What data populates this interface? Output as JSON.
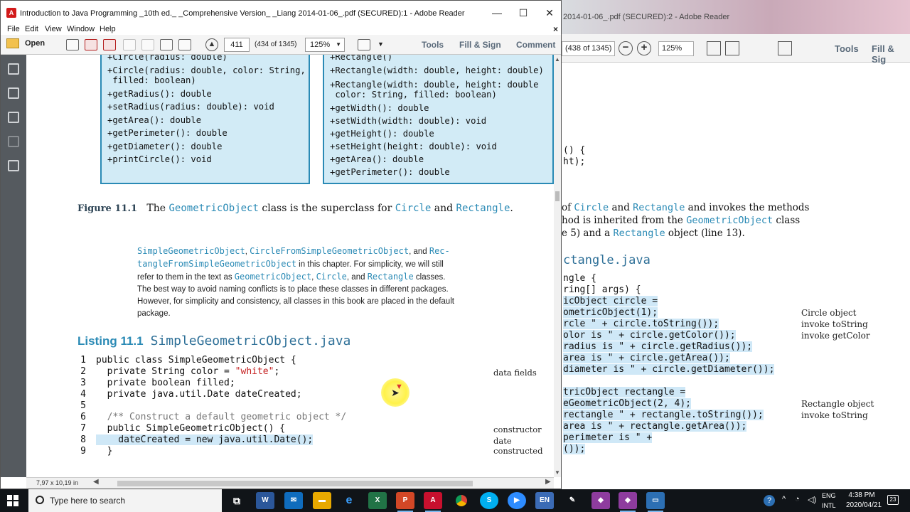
{
  "background_window": {
    "title": "2014-01-06_.pdf (SECURED):2 - Adobe Reader",
    "page_count": "(438 of 1345)",
    "zoom": "125%",
    "tools_label": "Tools",
    "fill_sign_label": "Fill & Sig",
    "code_top": [
      "() {",
      "ht);"
    ],
    "text_lines": [
      {
        "pre": "of ",
        "k1": "Circle",
        "mid": " and ",
        "k2": "Rectangle",
        "post": " and invokes the methods"
      },
      {
        "pre": "hod is inherited from the ",
        "k1": "GeometricObject",
        "mid": " class",
        "k2": "",
        "post": ""
      },
      {
        "pre": "e 5) and a ",
        "k1": "Rectangle",
        "mid": " object (line 13).",
        "k2": "",
        "post": ""
      }
    ],
    "heading": "ctangle.java",
    "code_lines": [
      "ngle {",
      "ring[] args) {",
      "icObject circle =",
      "ometricObject(1);",
      "rcle \" + circle.toString());",
      "olor is \" + circle.getColor());",
      "radius is \" + circle.getRadius());",
      "area is \" + circle.getArea());",
      "diameter is \" + circle.getDiameter());",
      "",
      "tricObject rectangle =",
      "eGeometricObject(2, 4);",
      "rectangle \" + rectangle.toString());",
      "area is \" + rectangle.getArea());",
      "perimeter is \" +",
      "());"
    ],
    "annotations": [
      "Circle object",
      "invoke toString",
      "invoke getColor",
      "Rectangle object",
      "invoke toString"
    ]
  },
  "window": {
    "title": "Introduction to Java Programming _10th ed._ _Comprehensive Version_ _Liang 2014-01-06_.pdf (SECURED):1 - Adobe Reader",
    "minimize": "—",
    "maximize": "☐",
    "close": "✕"
  },
  "menu": [
    "File",
    "Edit",
    "View",
    "Window",
    "Help"
  ],
  "menu_close": "×",
  "toolbar": {
    "open_label": "Open",
    "page_number": "411",
    "page_count": "(434 of 1345)",
    "zoom": "125%",
    "tools_label": "Tools",
    "fill_sign_label": "Fill & Sign",
    "comment_label": "Comment"
  },
  "page": {
    "circle_uml": [
      "+Circle(radius: double)",
      "+Circle(radius: double, color: String,",
      " filled: boolean)",
      "+getRadius(): double",
      "+setRadius(radius: double): void",
      "+getArea(): double",
      "+getPerimeter(): double",
      "+getDiameter(): double",
      "+printCircle(): void"
    ],
    "rectangle_uml": [
      "+Rectangle()",
      "+Rectangle(width: double, height: double)",
      "+Rectangle(width: double, height: double",
      " color: String, filled: boolean)",
      "+getWidth(): double",
      "+setWidth(width: double): void",
      "+getHeight(): double",
      "+setHeight(height: double): void",
      "+getArea(): double",
      "+getPerimeter(): double"
    ],
    "figure": {
      "label": "Figure 11.1",
      "pre": "The ",
      "k1": "GeometricObject",
      "mid1": " class is the superclass for ",
      "k2": "Circle",
      "mid2": " and ",
      "k3": "Rectangle",
      "post": "."
    },
    "note": {
      "k1": "SimpleGeometricObject",
      "k2": "CircleFromSimpleGeometricObject",
      "and": ", and ",
      "k3a": "Rec-",
      "k3b": "tangleFromSimpleGeometricObject",
      "t1": " in this chapter. For simplicity, we will still",
      "t2": "refer to them in the text as ",
      "k4": "GeometricObject",
      "k5": "Circle",
      "k6": "Rectangle",
      "t3": " classes.",
      "t4": "The best way to avoid naming conflicts is to place these classes in different packages.",
      "t5": "However, for simplicity and consistency, all classes in this book are placed in the default",
      "t6": "package."
    },
    "listing": {
      "label": "Listing 11.1",
      "file": "SimpleGeometricObject.java"
    },
    "code": [
      {
        "n": "1",
        "t": "public class SimpleGeometricObject {"
      },
      {
        "n": "2",
        "t": "  private String color = ",
        "s": "\"white\"",
        "e": ";"
      },
      {
        "n": "3",
        "t": "  private boolean filled;"
      },
      {
        "n": "4",
        "t": "  private java.util.Date dateCreated;"
      },
      {
        "n": "5",
        "t": ""
      },
      {
        "n": "6",
        "c": "  /** Construct a default geometric object */"
      },
      {
        "n": "7",
        "t": "  public SimpleGeometricObject() {"
      },
      {
        "n": "8",
        "h": "    dateCreated = new java.util.Date();"
      },
      {
        "n": "9",
        "t": "  }"
      }
    ],
    "side_notes": [
      "data fields",
      "constructor",
      "date constructed"
    ]
  },
  "status": {
    "dimensions": "7,97 x 10,19 in"
  },
  "taskbar": {
    "search_placeholder": "Type here to search",
    "lang_1": "ENG",
    "lang_2": "INTL",
    "time": "4:38 PM",
    "date": "2020/04/21",
    "notif_count": "23",
    "apps": [
      "task-view",
      "word",
      "mail",
      "file-explorer",
      "edge",
      "excel",
      "powerpoint",
      "adobe-reader",
      "chrome",
      "skype",
      "zoom",
      "en-app",
      "app-1",
      "app-2",
      "app-3",
      "app-4"
    ]
  },
  "colors": {
    "uml_fill": "#d2ebf6",
    "uml_border": "#2a8ab5",
    "keyword": "#2a8ab5",
    "taskbar": "#101418"
  }
}
